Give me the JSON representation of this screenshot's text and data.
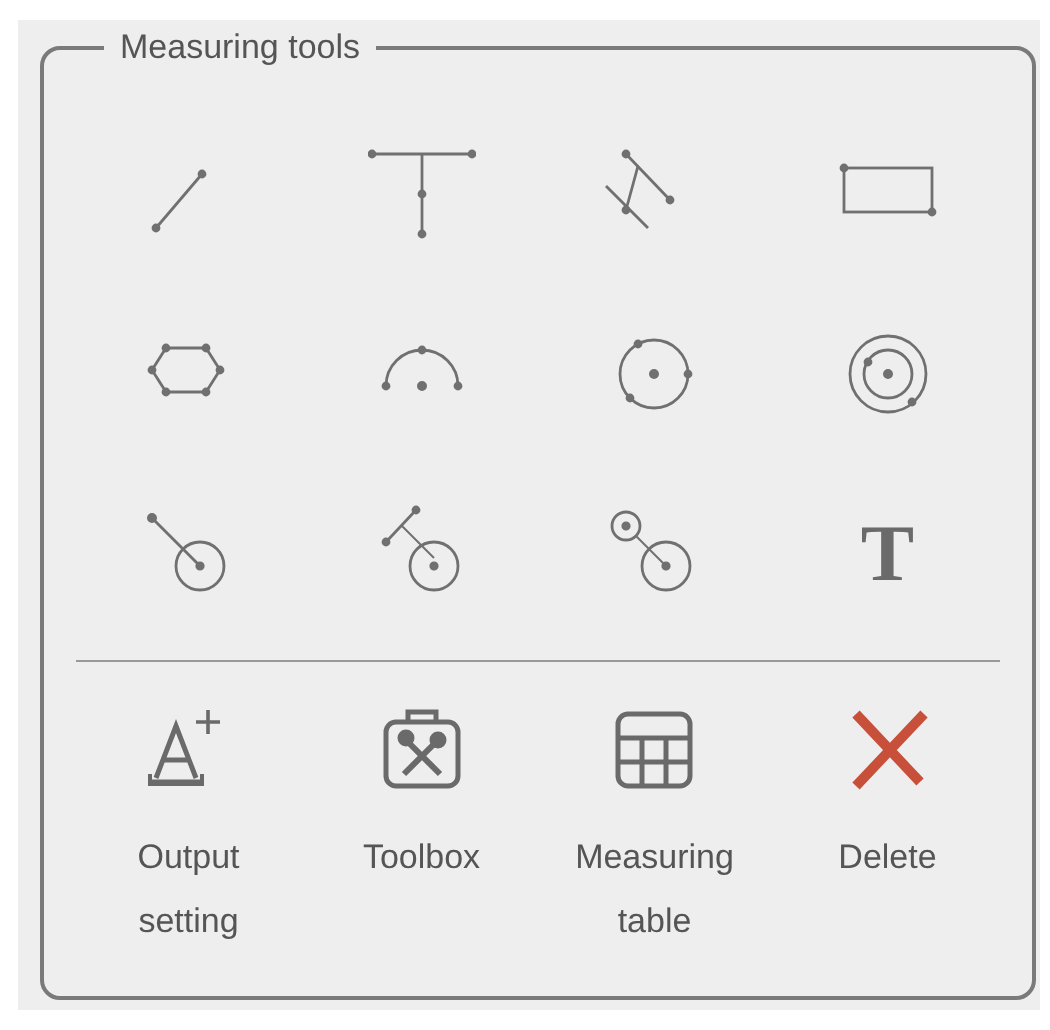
{
  "panel": {
    "title": "Measuring tools"
  },
  "tools": [
    {
      "kind": "line"
    },
    {
      "kind": "perpendicular"
    },
    {
      "kind": "parallel"
    },
    {
      "kind": "rectangle"
    },
    {
      "kind": "polygon"
    },
    {
      "kind": "arc"
    },
    {
      "kind": "circle"
    },
    {
      "kind": "concentric"
    },
    {
      "kind": "point-circle"
    },
    {
      "kind": "line-circle"
    },
    {
      "kind": "circle-circle"
    },
    {
      "kind": "text",
      "glyph": "T"
    }
  ],
  "actions": [
    {
      "kind": "output",
      "label": "Output setting"
    },
    {
      "kind": "toolbox",
      "label": "Toolbox"
    },
    {
      "kind": "table",
      "label": "Measuring table"
    },
    {
      "kind": "delete",
      "label": "Delete"
    }
  ]
}
